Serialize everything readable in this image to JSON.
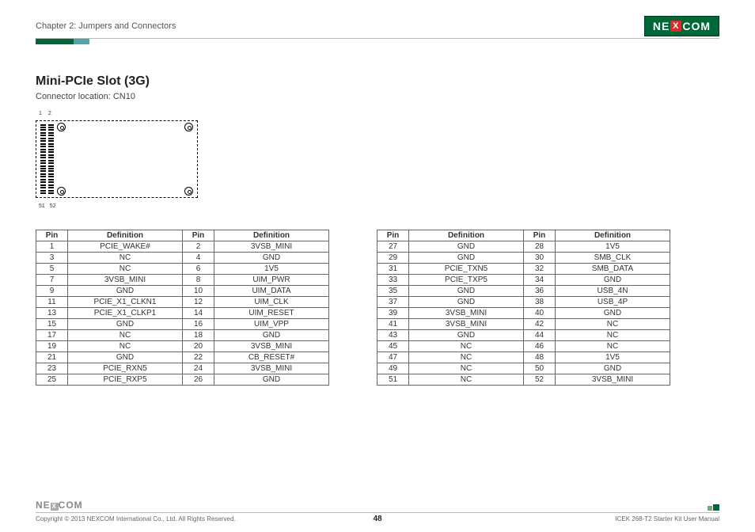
{
  "header": {
    "chapter": "Chapter 2: Jumpers and Connectors",
    "logo_text_left": "NE",
    "logo_text_x": "X",
    "logo_text_right": "COM"
  },
  "section": {
    "title": "Mini-PCIe Slot (3G)",
    "subtitle": "Connector location: CN10"
  },
  "diagram": {
    "pin_top_1": "1",
    "pin_top_2": "2",
    "pin_bot_1": "51",
    "pin_bot_2": "52"
  },
  "table_headers": {
    "pin": "Pin",
    "def": "Definition"
  },
  "table1": [
    {
      "p1": "1",
      "d1": "PCIE_WAKE#",
      "p2": "2",
      "d2": "3VSB_MINI"
    },
    {
      "p1": "3",
      "d1": "NC",
      "p2": "4",
      "d2": "GND"
    },
    {
      "p1": "5",
      "d1": "NC",
      "p2": "6",
      "d2": "1V5"
    },
    {
      "p1": "7",
      "d1": "3VSB_MINI",
      "p2": "8",
      "d2": "UIM_PWR"
    },
    {
      "p1": "9",
      "d1": "GND",
      "p2": "10",
      "d2": "UIM_DATA"
    },
    {
      "p1": "11",
      "d1": "PCIE_X1_CLKN1",
      "p2": "12",
      "d2": "UIM_CLK"
    },
    {
      "p1": "13",
      "d1": "PCIE_X1_CLKP1",
      "p2": "14",
      "d2": "UIM_RESET"
    },
    {
      "p1": "15",
      "d1": "GND",
      "p2": "16",
      "d2": "UIM_VPP"
    },
    {
      "p1": "17",
      "d1": "NC",
      "p2": "18",
      "d2": "GND"
    },
    {
      "p1": "19",
      "d1": "NC",
      "p2": "20",
      "d2": "3VSB_MINI"
    },
    {
      "p1": "21",
      "d1": "GND",
      "p2": "22",
      "d2": "CB_RESET#"
    },
    {
      "p1": "23",
      "d1": "PCIE_RXN5",
      "p2": "24",
      "d2": "3VSB_MINI"
    },
    {
      "p1": "25",
      "d1": "PCIE_RXP5",
      "p2": "26",
      "d2": "GND"
    }
  ],
  "table2": [
    {
      "p1": "27",
      "d1": "GND",
      "p2": "28",
      "d2": "1V5"
    },
    {
      "p1": "29",
      "d1": "GND",
      "p2": "30",
      "d2": "SMB_CLK"
    },
    {
      "p1": "31",
      "d1": "PCIE_TXN5",
      "p2": "32",
      "d2": "SMB_DATA"
    },
    {
      "p1": "33",
      "d1": "PCIE_TXP5",
      "p2": "34",
      "d2": "GND"
    },
    {
      "p1": "35",
      "d1": "GND",
      "p2": "36",
      "d2": "USB_4N"
    },
    {
      "p1": "37",
      "d1": "GND",
      "p2": "38",
      "d2": "USB_4P"
    },
    {
      "p1": "39",
      "d1": "3VSB_MINI",
      "p2": "40",
      "d2": "GND"
    },
    {
      "p1": "41",
      "d1": "3VSB_MINI",
      "p2": "42",
      "d2": "NC"
    },
    {
      "p1": "43",
      "d1": "GND",
      "p2": "44",
      "d2": "NC"
    },
    {
      "p1": "45",
      "d1": "NC",
      "p2": "46",
      "d2": "NC"
    },
    {
      "p1": "47",
      "d1": "NC",
      "p2": "48",
      "d2": "1V5"
    },
    {
      "p1": "49",
      "d1": "NC",
      "p2": "50",
      "d2": "GND"
    },
    {
      "p1": "51",
      "d1": "NC",
      "p2": "52",
      "d2": "3VSB_MINI"
    }
  ],
  "footer": {
    "copyright": "Copyright © 2013 NEXCOM International Co., Ltd. All Rights Reserved.",
    "page": "48",
    "manual": "ICEK 268-T2 Starter Kit User Manual",
    "logo_left": "NE",
    "logo_x": "X",
    "logo_right": "COM"
  }
}
